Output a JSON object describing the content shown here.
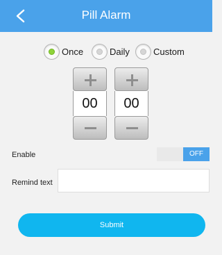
{
  "header": {
    "title": "Pill Alarm",
    "back_icon": "chevron-left-icon",
    "background_color": "#4aa2ea"
  },
  "frequency": {
    "options": [
      {
        "label": "Once",
        "selected": true
      },
      {
        "label": "Daily",
        "selected": false
      },
      {
        "label": "Custom",
        "selected": false
      }
    ],
    "selected_color": "#8fd33a"
  },
  "time_picker": {
    "hour": "00",
    "minute": "00"
  },
  "enable": {
    "label": "Enable",
    "state_label": "OFF",
    "toggle_color": "#4aa2ea"
  },
  "remind": {
    "label": "Remind text",
    "value": ""
  },
  "submit": {
    "label": "Submit",
    "color": "#10b6ef"
  }
}
